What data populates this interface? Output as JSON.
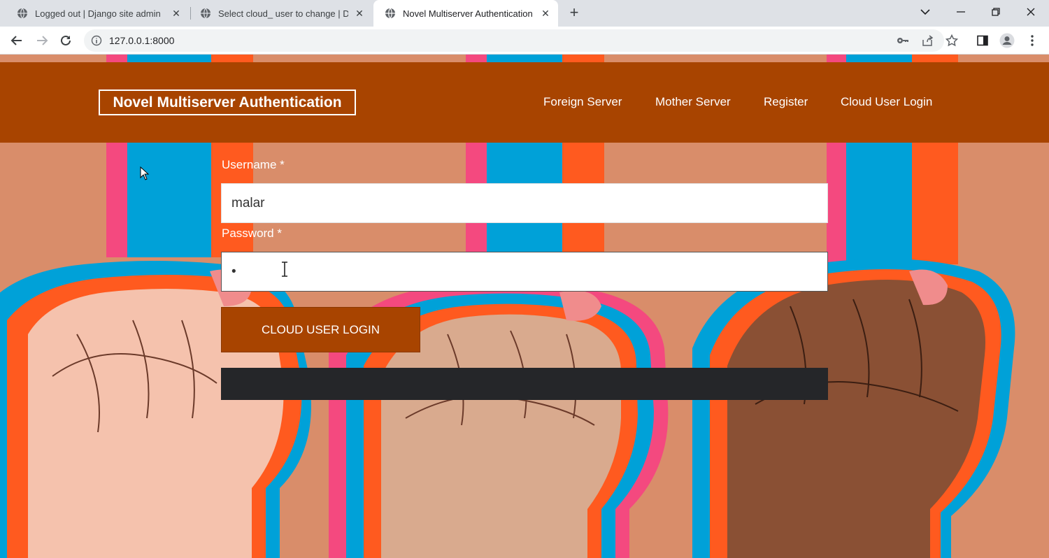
{
  "browser": {
    "tabs": [
      {
        "title": "Logged out | Django site admin",
        "active": false
      },
      {
        "title": "Select cloud_ user to change | Dj",
        "active": false
      },
      {
        "title": "Novel Multiserver Authentication",
        "active": true
      }
    ],
    "url": "127.0.0.1:8000"
  },
  "header": {
    "brand": "Novel Multiserver Authentication",
    "nav": [
      "Foreign Server",
      "Mother Server",
      "Register",
      "Cloud User Login"
    ]
  },
  "form": {
    "username_label": "Username *",
    "username_value": "malar",
    "password_label": "Password *",
    "password_value": "•",
    "submit_label": "CLOUD USER LOGIN"
  },
  "colors": {
    "header_bg": "#a84400",
    "button_bg": "#a84400",
    "page_bg": "#d98d6a",
    "stripe_blue": "#00a1d8",
    "stripe_orange": "#ff5a1f",
    "stripe_pink": "#f4497f",
    "dark_bar": "#252629"
  },
  "icons": [
    "globe-icon",
    "close-icon",
    "plus-icon",
    "chevron-down-icon",
    "minimize-icon",
    "restore-icon",
    "window-close-icon",
    "back-icon",
    "forward-icon",
    "reload-icon",
    "info-icon",
    "key-icon",
    "share-icon",
    "star-icon",
    "side-panel-icon",
    "profile-icon",
    "menu-icon"
  ]
}
